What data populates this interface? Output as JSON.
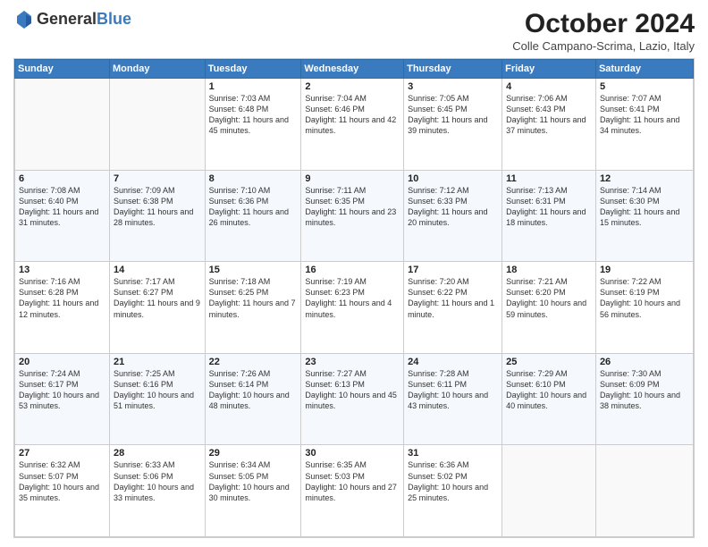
{
  "header": {
    "logo_line1": "General",
    "logo_line2": "Blue",
    "title": "October 2024",
    "subtitle": "Colle Campano-Scrima, Lazio, Italy"
  },
  "days_of_week": [
    "Sunday",
    "Monday",
    "Tuesday",
    "Wednesday",
    "Thursday",
    "Friday",
    "Saturday"
  ],
  "weeks": [
    [
      {
        "day": "",
        "info": ""
      },
      {
        "day": "",
        "info": ""
      },
      {
        "day": "1",
        "info": "Sunrise: 7:03 AM\nSunset: 6:48 PM\nDaylight: 11 hours and 45 minutes."
      },
      {
        "day": "2",
        "info": "Sunrise: 7:04 AM\nSunset: 6:46 PM\nDaylight: 11 hours and 42 minutes."
      },
      {
        "day": "3",
        "info": "Sunrise: 7:05 AM\nSunset: 6:45 PM\nDaylight: 11 hours and 39 minutes."
      },
      {
        "day": "4",
        "info": "Sunrise: 7:06 AM\nSunset: 6:43 PM\nDaylight: 11 hours and 37 minutes."
      },
      {
        "day": "5",
        "info": "Sunrise: 7:07 AM\nSunset: 6:41 PM\nDaylight: 11 hours and 34 minutes."
      }
    ],
    [
      {
        "day": "6",
        "info": "Sunrise: 7:08 AM\nSunset: 6:40 PM\nDaylight: 11 hours and 31 minutes."
      },
      {
        "day": "7",
        "info": "Sunrise: 7:09 AM\nSunset: 6:38 PM\nDaylight: 11 hours and 28 minutes."
      },
      {
        "day": "8",
        "info": "Sunrise: 7:10 AM\nSunset: 6:36 PM\nDaylight: 11 hours and 26 minutes."
      },
      {
        "day": "9",
        "info": "Sunrise: 7:11 AM\nSunset: 6:35 PM\nDaylight: 11 hours and 23 minutes."
      },
      {
        "day": "10",
        "info": "Sunrise: 7:12 AM\nSunset: 6:33 PM\nDaylight: 11 hours and 20 minutes."
      },
      {
        "day": "11",
        "info": "Sunrise: 7:13 AM\nSunset: 6:31 PM\nDaylight: 11 hours and 18 minutes."
      },
      {
        "day": "12",
        "info": "Sunrise: 7:14 AM\nSunset: 6:30 PM\nDaylight: 11 hours and 15 minutes."
      }
    ],
    [
      {
        "day": "13",
        "info": "Sunrise: 7:16 AM\nSunset: 6:28 PM\nDaylight: 11 hours and 12 minutes."
      },
      {
        "day": "14",
        "info": "Sunrise: 7:17 AM\nSunset: 6:27 PM\nDaylight: 11 hours and 9 minutes."
      },
      {
        "day": "15",
        "info": "Sunrise: 7:18 AM\nSunset: 6:25 PM\nDaylight: 11 hours and 7 minutes."
      },
      {
        "day": "16",
        "info": "Sunrise: 7:19 AM\nSunset: 6:23 PM\nDaylight: 11 hours and 4 minutes."
      },
      {
        "day": "17",
        "info": "Sunrise: 7:20 AM\nSunset: 6:22 PM\nDaylight: 11 hours and 1 minute."
      },
      {
        "day": "18",
        "info": "Sunrise: 7:21 AM\nSunset: 6:20 PM\nDaylight: 10 hours and 59 minutes."
      },
      {
        "day": "19",
        "info": "Sunrise: 7:22 AM\nSunset: 6:19 PM\nDaylight: 10 hours and 56 minutes."
      }
    ],
    [
      {
        "day": "20",
        "info": "Sunrise: 7:24 AM\nSunset: 6:17 PM\nDaylight: 10 hours and 53 minutes."
      },
      {
        "day": "21",
        "info": "Sunrise: 7:25 AM\nSunset: 6:16 PM\nDaylight: 10 hours and 51 minutes."
      },
      {
        "day": "22",
        "info": "Sunrise: 7:26 AM\nSunset: 6:14 PM\nDaylight: 10 hours and 48 minutes."
      },
      {
        "day": "23",
        "info": "Sunrise: 7:27 AM\nSunset: 6:13 PM\nDaylight: 10 hours and 45 minutes."
      },
      {
        "day": "24",
        "info": "Sunrise: 7:28 AM\nSunset: 6:11 PM\nDaylight: 10 hours and 43 minutes."
      },
      {
        "day": "25",
        "info": "Sunrise: 7:29 AM\nSunset: 6:10 PM\nDaylight: 10 hours and 40 minutes."
      },
      {
        "day": "26",
        "info": "Sunrise: 7:30 AM\nSunset: 6:09 PM\nDaylight: 10 hours and 38 minutes."
      }
    ],
    [
      {
        "day": "27",
        "info": "Sunrise: 6:32 AM\nSunset: 5:07 PM\nDaylight: 10 hours and 35 minutes."
      },
      {
        "day": "28",
        "info": "Sunrise: 6:33 AM\nSunset: 5:06 PM\nDaylight: 10 hours and 33 minutes."
      },
      {
        "day": "29",
        "info": "Sunrise: 6:34 AM\nSunset: 5:05 PM\nDaylight: 10 hours and 30 minutes."
      },
      {
        "day": "30",
        "info": "Sunrise: 6:35 AM\nSunset: 5:03 PM\nDaylight: 10 hours and 27 minutes."
      },
      {
        "day": "31",
        "info": "Sunrise: 6:36 AM\nSunset: 5:02 PM\nDaylight: 10 hours and 25 minutes."
      },
      {
        "day": "",
        "info": ""
      },
      {
        "day": "",
        "info": ""
      }
    ]
  ]
}
